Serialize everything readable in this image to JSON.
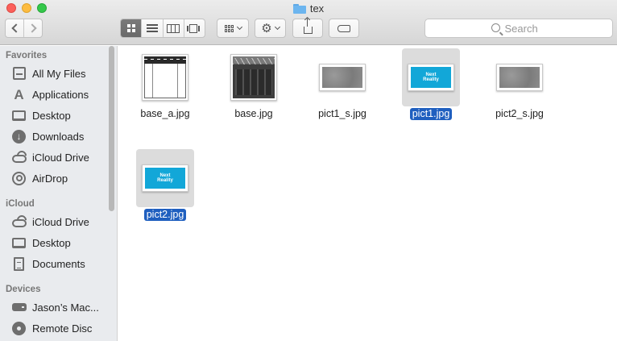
{
  "window": {
    "title": "tex",
    "colors": {
      "close": "#fc605b",
      "minimize": "#fdbc40",
      "maximize": "#34c84a"
    }
  },
  "toolbar": {
    "view_mode_active": "icon",
    "search_placeholder": "Search"
  },
  "sidebar": {
    "sections": [
      {
        "heading": "Favorites",
        "items": [
          {
            "label": "All My Files",
            "icon": "all-my-files-icon"
          },
          {
            "label": "Applications",
            "icon": "applications-icon"
          },
          {
            "label": "Desktop",
            "icon": "desktop-icon"
          },
          {
            "label": "Downloads",
            "icon": "downloads-icon"
          },
          {
            "label": "iCloud Drive",
            "icon": "icloud-drive-icon"
          },
          {
            "label": "AirDrop",
            "icon": "airdrop-icon"
          }
        ]
      },
      {
        "heading": "iCloud",
        "items": [
          {
            "label": "iCloud Drive",
            "icon": "icloud-drive-icon"
          },
          {
            "label": "Desktop",
            "icon": "desktop-icon"
          },
          {
            "label": "Documents",
            "icon": "documents-icon"
          }
        ]
      },
      {
        "heading": "Devices",
        "items": [
          {
            "label": "Jason’s Mac...",
            "icon": "hard-drive-icon"
          },
          {
            "label": "Remote Disc",
            "icon": "remote-disc-icon"
          }
        ]
      }
    ]
  },
  "files": [
    {
      "name": "base_a.jpg",
      "selected": false
    },
    {
      "name": "base.jpg",
      "selected": false
    },
    {
      "name": "pict1_s.jpg",
      "selected": false
    },
    {
      "name": "pict1.jpg",
      "selected": true,
      "thumb_text": [
        "Next",
        "Reality"
      ]
    },
    {
      "name": "pict2_s.jpg",
      "selected": false
    },
    {
      "name": "pict2.jpg",
      "selected": true,
      "thumb_text": [
        "Next",
        "Reality"
      ]
    }
  ],
  "colors": {
    "selection": "#1f5fbf",
    "thumb_brand": "#12a7d8"
  }
}
